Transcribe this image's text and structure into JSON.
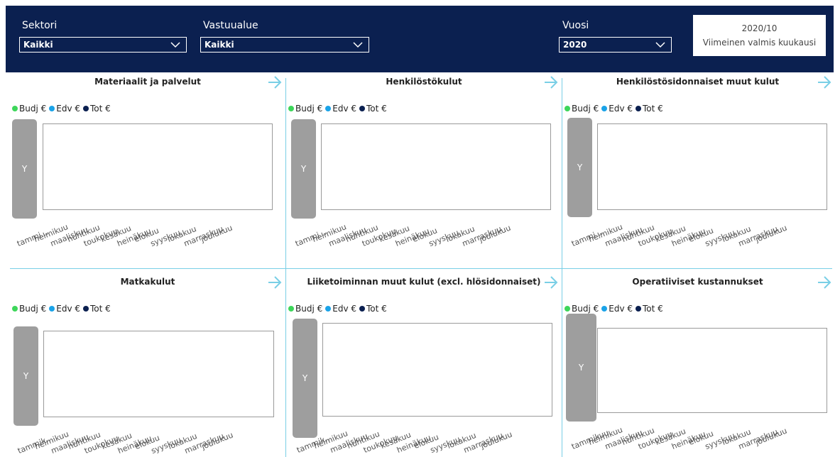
{
  "filters": {
    "sektori": {
      "label": "Sektori",
      "value": "Kaikki"
    },
    "vastuualue": {
      "label": "Vastuualue",
      "value": "Kaikki"
    },
    "vuosi": {
      "label": "Vuosi",
      "value": "2020"
    }
  },
  "status": {
    "period": "2020/10",
    "caption": "Viimeinen valmis kuukausi"
  },
  "legend": [
    {
      "label": "Budj €",
      "color": "#3dd65a"
    },
    {
      "label": "Edv €",
      "color": "#1aa3e8"
    },
    {
      "label": "Tot €",
      "color": "#0b2050"
    }
  ],
  "yaxis_label": "Y",
  "months": [
    "tammikuu",
    "helmikuu",
    "maaliskuu",
    "huhtikuu",
    "toukokuu",
    "kesäkuu",
    "heinäkuu",
    "elokuu",
    "syyskuu",
    "lokakuu",
    "marraskuu",
    "joulukuu"
  ],
  "first_month_truncated": "tammi...",
  "first_month_truncated_b": "tammik...",
  "panels": [
    {
      "title": "Materiaalit ja palvelut"
    },
    {
      "title": "Henkilöstökulut"
    },
    {
      "title": "Henkilöstösidonnaiset muut kulut"
    },
    {
      "title": "Matkakulut"
    },
    {
      "title": "Liiketoiminnan muut kulut (excl. hlösidonnaiset)"
    },
    {
      "title": "Operatiiviset kustannukset"
    }
  ],
  "accent_color": "#79cfe6",
  "header_color": "#0b2050"
}
